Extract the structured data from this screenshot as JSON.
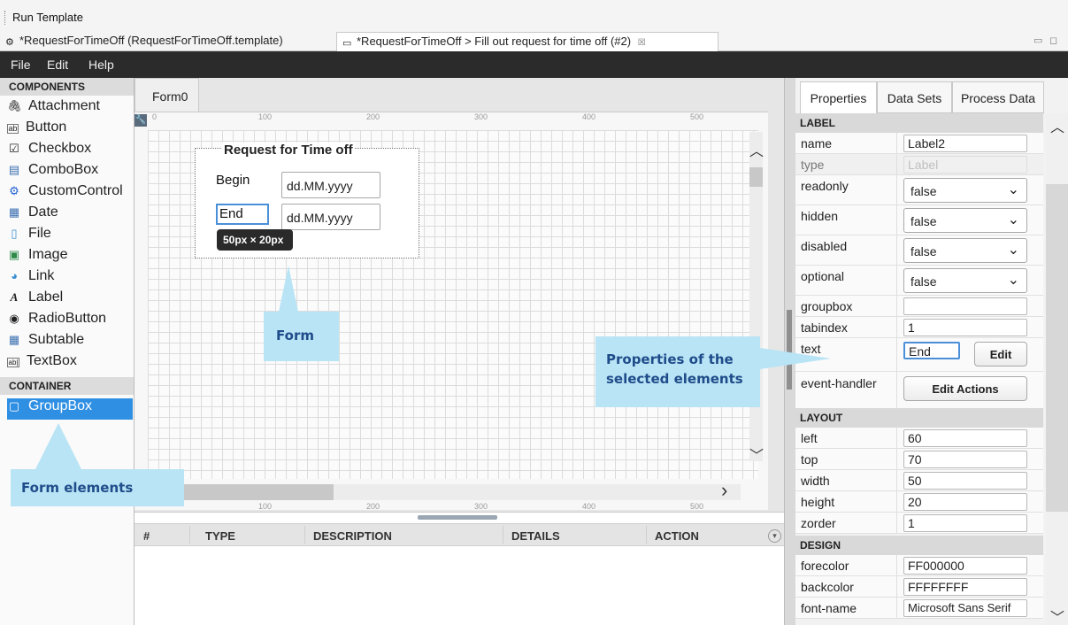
{
  "toolbar": {
    "run_template": "Run Template"
  },
  "editor_tabs": [
    {
      "label": "*RequestForTimeOff (RequestForTimeOff.template)"
    },
    {
      "label": "*RequestForTimeOff > Fill out request for time off  (#2)",
      "close": "☒"
    }
  ],
  "menu": [
    "File",
    "Edit",
    "Help"
  ],
  "components": {
    "header": "COMPONENTS",
    "items": [
      {
        "label": "Attachment",
        "icon": "paperclip-icon",
        "glyph": "🖇"
      },
      {
        "label": "Button",
        "icon": "button-icon",
        "glyph": "ab"
      },
      {
        "label": "Checkbox",
        "icon": "checkbox-icon",
        "glyph": "☑"
      },
      {
        "label": "ComboBox",
        "icon": "combobox-icon",
        "glyph": "▤"
      },
      {
        "label": "CustomControl",
        "icon": "custom-control-icon",
        "glyph": "⚙"
      },
      {
        "label": "Date",
        "icon": "calendar-icon",
        "glyph": "▦"
      },
      {
        "label": "File",
        "icon": "file-icon",
        "glyph": "▯"
      },
      {
        "label": "Image",
        "icon": "image-icon",
        "glyph": "▣"
      },
      {
        "label": "Link",
        "icon": "link-icon",
        "glyph": "◕"
      },
      {
        "label": "Label",
        "icon": "label-icon",
        "glyph": "A"
      },
      {
        "label": "RadioButton",
        "icon": "radio-button-icon",
        "glyph": "◉"
      },
      {
        "label": "Subtable",
        "icon": "table-icon",
        "glyph": "▦"
      },
      {
        "label": "TextBox",
        "icon": "textbox-icon",
        "glyph": "ab|"
      }
    ]
  },
  "container": {
    "header": "CONTAINER",
    "items": [
      {
        "label": "GroupBox",
        "icon": "groupbox-icon",
        "glyph": "▢",
        "selected": true
      }
    ]
  },
  "canvas": {
    "tab": "Form0",
    "ruler_top": [
      "0",
      "100",
      "200",
      "300",
      "400",
      "500"
    ],
    "ruler_bottom": [
      "100",
      "200",
      "300",
      "400",
      "500"
    ],
    "form": {
      "title": "Request for Time off",
      "begin_label": "Begin",
      "begin_value": "dd.MM.yyyy",
      "end_label": "End",
      "end_value": "dd.MM.yyyy"
    },
    "size_tooltip": "50px × 20px"
  },
  "table": {
    "columns": [
      "#",
      "TYPE",
      "DESCRIPTION",
      "DETAILS",
      "ACTION"
    ]
  },
  "properties": {
    "tabs": [
      "Properties",
      "Data Sets",
      "Process Data"
    ],
    "active_tab": "Properties",
    "label_section": "LABEL",
    "name_label": "name",
    "name_value": "Label2",
    "type_label": "type",
    "type_value": "Label",
    "readonly_label": "readonly",
    "readonly_value": "false",
    "hidden_label": "hidden",
    "hidden_value": "false",
    "disabled_label": "disabled",
    "disabled_value": "false",
    "optional_label": "optional",
    "optional_value": "false",
    "groupbox_label": "groupbox",
    "groupbox_value": "",
    "tabindex_label": "tabindex",
    "tabindex_value": "1",
    "text_label": "text",
    "text_value": "End",
    "edit_button": "Edit",
    "event_handler_label": "event-handler",
    "edit_actions_button": "Edit Actions",
    "layout_section": "LAYOUT",
    "left_label": "left",
    "left_value": "60",
    "top_label": "top",
    "top_value": "70",
    "width_label": "width",
    "width_value": "50",
    "height_label": "height",
    "height_value": "20",
    "zorder_label": "zorder",
    "zorder_value": "1",
    "design_section": "DESIGN",
    "forecolor_label": "forecolor",
    "forecolor_value": "FF000000",
    "backcolor_label": "backcolor",
    "backcolor_value": "FFFFFFFF",
    "font_name_label": "font-name",
    "font_name_value": "Microsoft Sans Serif"
  },
  "callouts": {
    "form": "Form",
    "properties_line1": "Properties of the",
    "properties_line2": "selected elements",
    "form_elements": "Form elements"
  },
  "colors": {
    "menubar": "#2b2b2b",
    "selection": "#2f8fe3",
    "callout": "#b9e4f5",
    "callout_text": "#1f4c8a"
  }
}
